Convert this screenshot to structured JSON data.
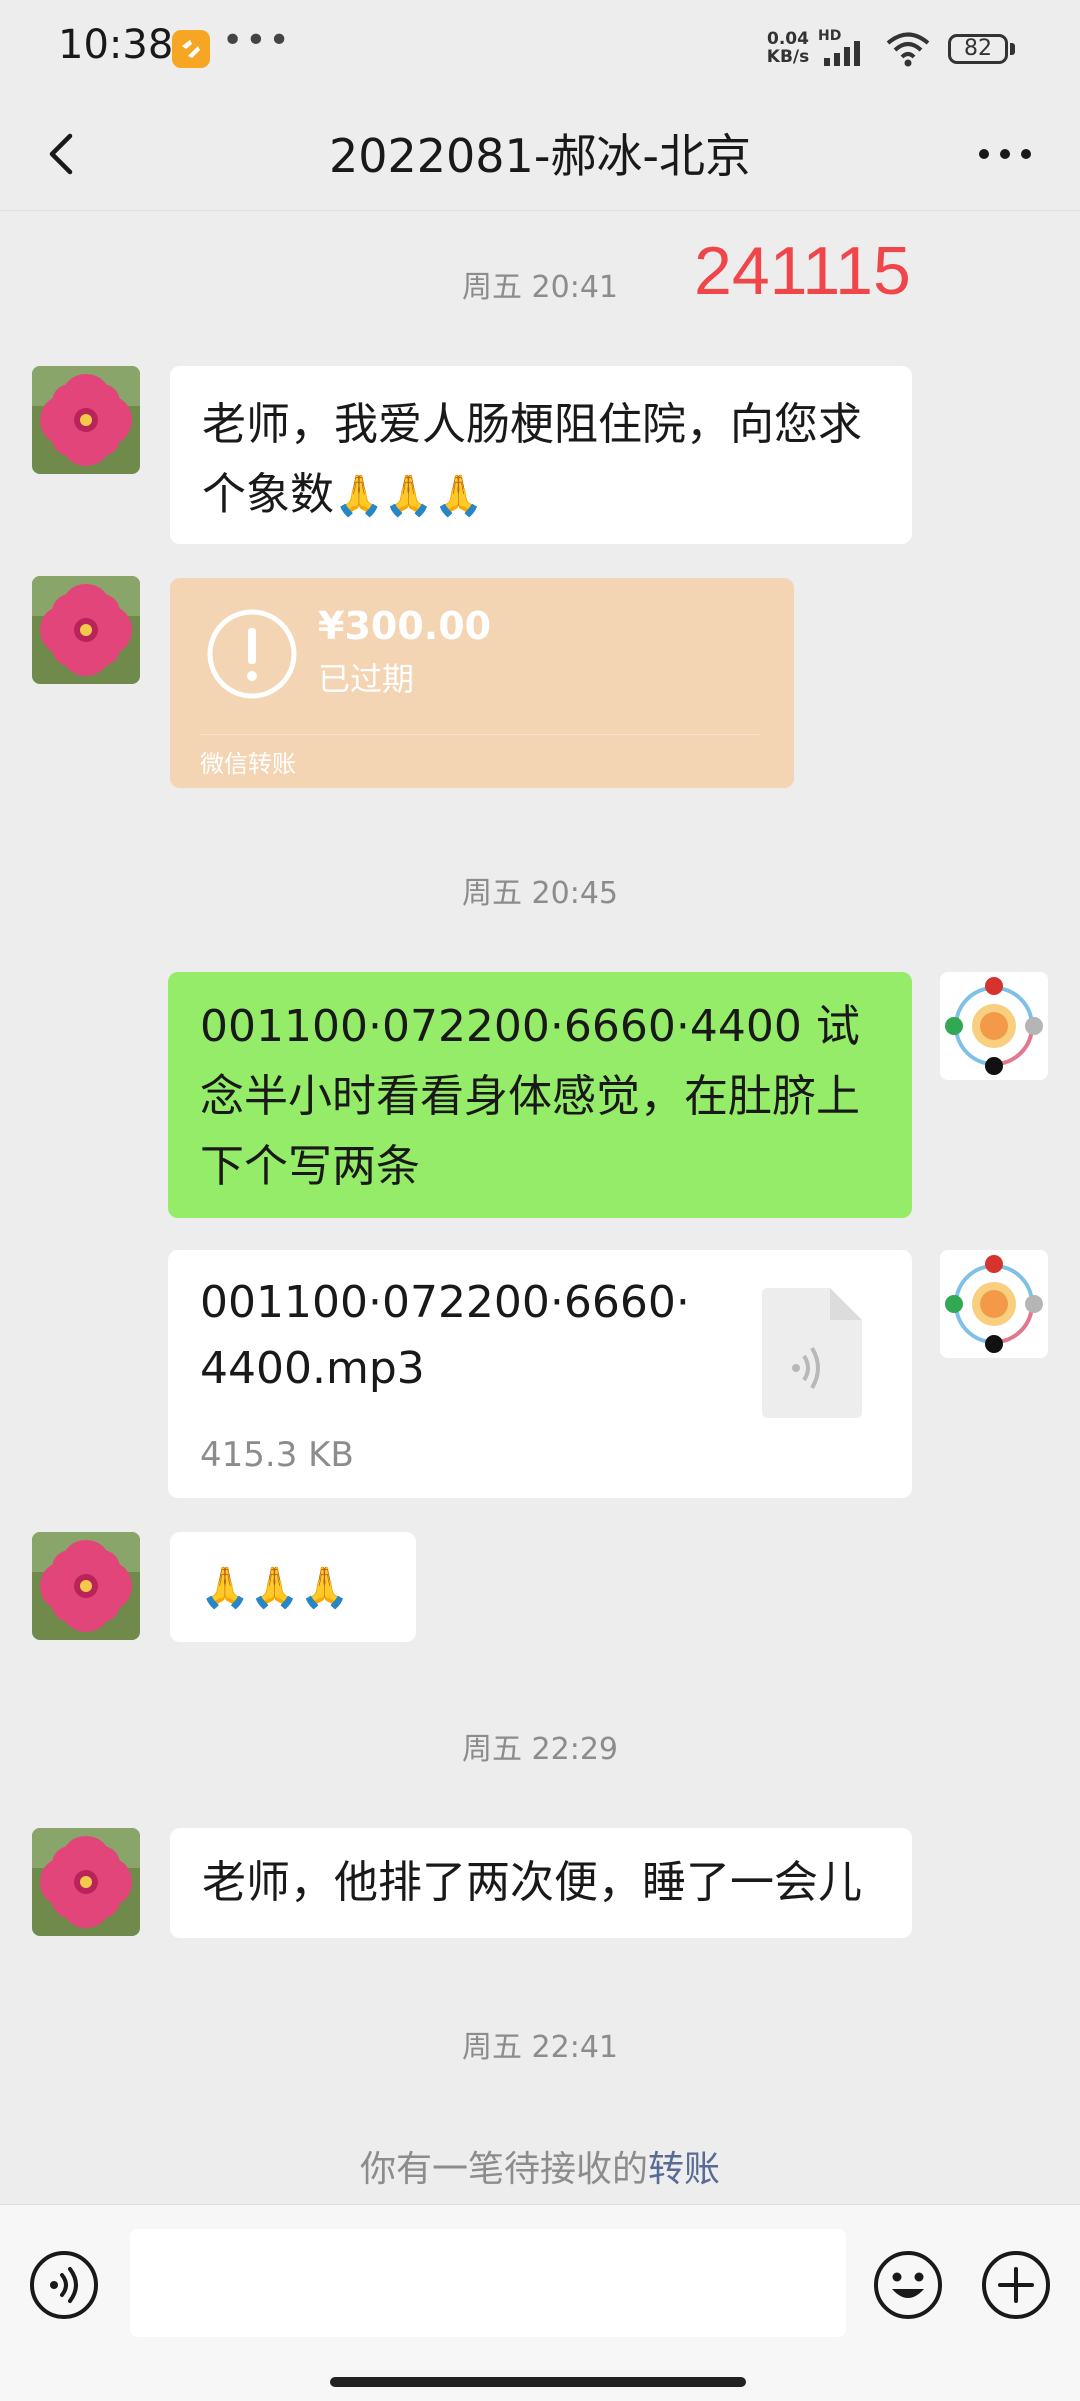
{
  "status_bar": {
    "time": "10:38",
    "more": "•••",
    "net_speed": "0.04",
    "net_unit": "KB/s",
    "hd": "HD",
    "battery": "82"
  },
  "header": {
    "title": "2022081-郝冰-北京",
    "back_icon": "chevron-left-icon",
    "more_icon": "more-dots-icon"
  },
  "annotation": "241115",
  "messages": {
    "ts1": "周五 20:41",
    "msg1": "老师，我爱人肠梗阻住院，向您求个象数",
    "msg1_emoji": "🙏🙏🙏",
    "transfer": {
      "amount": "¥300.00",
      "status": "已过期",
      "source": "微信转账"
    },
    "ts2": "周五 20:45",
    "msg2": "001100·072200·6660·4400 试念半小时看看身体感觉，在肚脐上下个写两条",
    "file": {
      "name": "001100·072200·6660·4400.mp3",
      "size": "415.3 KB"
    },
    "msg3": "🙏🙏🙏",
    "ts3": "周五 22:29",
    "msg4": "老师，他排了两次便，睡了一会儿",
    "ts4": "周五 22:41",
    "pending_prefix": "你有一笔待接收的",
    "pending_link": "转账"
  },
  "input": {
    "placeholder": "",
    "voice_icon": "voice-icon",
    "emoji_icon": "emoji-icon",
    "plus_icon": "plus-icon"
  },
  "colors": {
    "chat_bg": "#ededed",
    "own_bubble": "#95ec69",
    "transfer_bg": "#f3d4b3",
    "annotation": "#f0464a",
    "link": "#576b95"
  }
}
